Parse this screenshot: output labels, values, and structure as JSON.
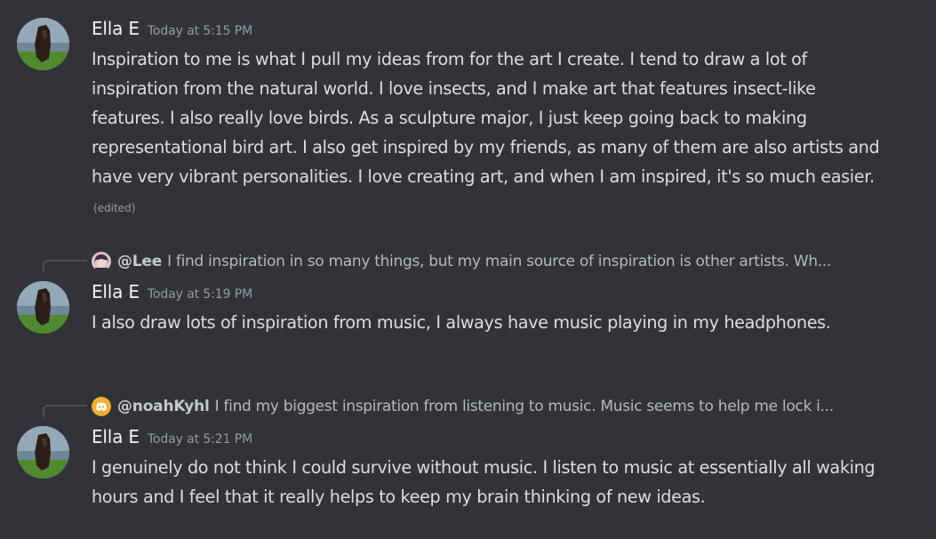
{
  "messages": [
    {
      "author": "Ella E",
      "timestamp": "Today at 5:15 PM",
      "text": "Inspiration to me is what I pull my ideas from for the art I create. I tend to draw a lot of inspiration from the natural world. I love insects, and I make art that features insect-like features. I also really love birds. As a sculpture major, I just keep going back to making representational bird art. I also get inspired by my friends, as many of them are also artists and have very vibrant personalities. I love creating art, and when I am inspired, it's so much easier.",
      "edited_label": "(edited)",
      "avatar_icon": "horse-photo-avatar"
    },
    {
      "reply": {
        "user": "@Lee",
        "text": "I find inspiration in so many things, but my main source of inspiration is other artists. Wh...",
        "avatar_icon": "anime-character-avatar"
      },
      "author": "Ella E",
      "timestamp": "Today at 5:19 PM",
      "text": "I also draw lots of inspiration from music, I always have music playing in my headphones.",
      "avatar_icon": "horse-photo-avatar"
    },
    {
      "reply": {
        "user": "@noahKyhl",
        "text": "I find my biggest inspiration from listening to music. Music seems to help me lock i...",
        "avatar_icon": "discord-default-avatar",
        "avatar_color": "#f0b232"
      },
      "author": "Ella E",
      "timestamp": "Today at 5:21 PM",
      "text": "I genuinely do not think I could survive without music. I listen to music at essentially all waking hours and I feel that it really helps to keep my brain thinking of new ideas.",
      "avatar_icon": "horse-photo-avatar"
    }
  ],
  "colors": {
    "background": "#313338",
    "author": "#f2f3f5",
    "timestamp": "#949ba4",
    "text": "#dbdee1",
    "reply_text": "#b5bac1",
    "reply_spine": "#4e5058"
  }
}
